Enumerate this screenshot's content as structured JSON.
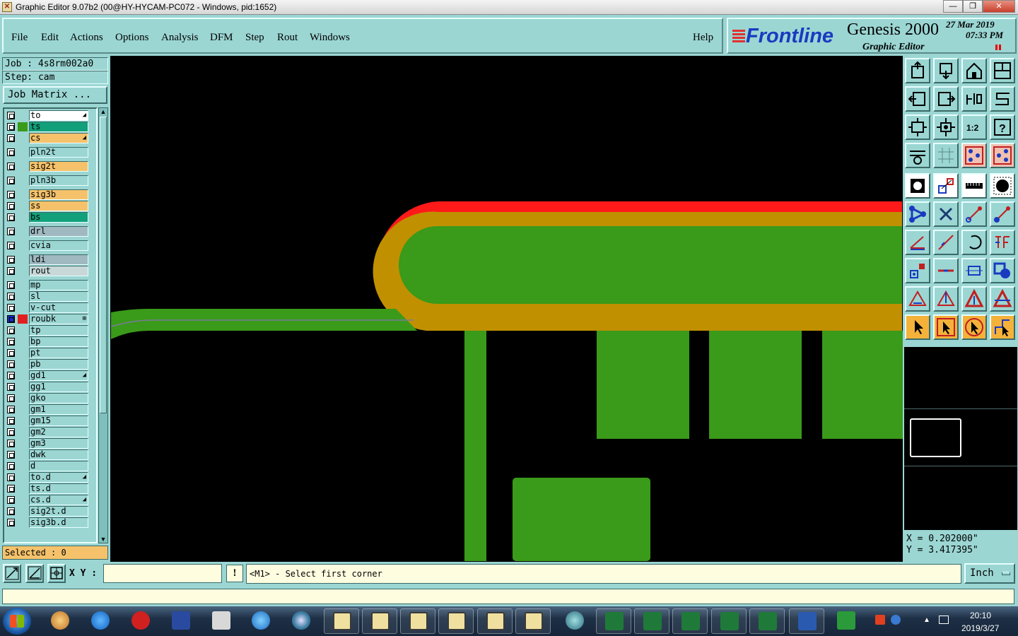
{
  "window": {
    "title": "Graphic Editor 9.07b2 (00@HY-HYCAM-PC072 - Windows, pid:1652)"
  },
  "menu": {
    "items": [
      "File",
      "Edit",
      "Actions",
      "Options",
      "Analysis",
      "DFM",
      "Step",
      "Rout",
      "Windows"
    ],
    "help": "Help"
  },
  "brand": {
    "logo": "Frontline",
    "product": "Genesis 2000",
    "subtitle": "Graphic Editor",
    "date": "27 Mar 2019",
    "time": "07:33 PM"
  },
  "job": {
    "job_label": "Job : 4s8rm002a0",
    "step_label": "Step: cam",
    "matrix_button": "Job Matrix ..."
  },
  "layers": [
    {
      "name": "to",
      "color": "#ffffff",
      "swatch": "",
      "mark": "◢"
    },
    {
      "name": "ts",
      "color": "#12a07a",
      "swatch": "#3a9a1a",
      "mark": ""
    },
    {
      "name": "cs",
      "color": "#f5c26b",
      "swatch": "",
      "mark": "◢"
    },
    {
      "name": "pln2t",
      "color": "#9bd6d3",
      "swatch": "",
      "mark": ""
    },
    {
      "name": "sig2t",
      "color": "#f5c26b",
      "swatch": "",
      "mark": ""
    },
    {
      "name": "pln3b",
      "color": "#9bd6d3",
      "swatch": "",
      "mark": ""
    },
    {
      "name": "sig3b",
      "color": "#f5c26b",
      "swatch": "",
      "mark": ""
    },
    {
      "name": "ss",
      "color": "#f5c26b",
      "swatch": "",
      "mark": ""
    },
    {
      "name": "bs",
      "color": "#12a07a",
      "swatch": "",
      "mark": ""
    },
    {
      "name": "drl",
      "color": "#a0b8c0",
      "swatch": "",
      "mark": ""
    },
    {
      "name": "cvia",
      "color": "#9bd6d3",
      "swatch": "",
      "mark": ""
    },
    {
      "name": "ldi",
      "color": "#a0b8c0",
      "swatch": "",
      "mark": ""
    },
    {
      "name": "rout",
      "color": "#c8d8d8",
      "swatch": "",
      "mark": ""
    },
    {
      "name": "mp",
      "color": "#9bd6d3",
      "swatch": "",
      "mark": ""
    },
    {
      "name": "sl",
      "color": "#9bd6d3",
      "swatch": "",
      "mark": ""
    },
    {
      "name": "v-cut",
      "color": "#9bd6d3",
      "swatch": "",
      "mark": ""
    },
    {
      "name": "roubk",
      "color": "#9bd6d3",
      "swatch": "#e02020",
      "mark": "⊞",
      "active": true
    },
    {
      "name": "tp",
      "color": "#9bd6d3",
      "swatch": "",
      "mark": ""
    },
    {
      "name": "bp",
      "color": "#9bd6d3",
      "swatch": "",
      "mark": ""
    },
    {
      "name": "pt",
      "color": "#9bd6d3",
      "swatch": "",
      "mark": ""
    },
    {
      "name": "pb",
      "color": "#9bd6d3",
      "swatch": "",
      "mark": ""
    },
    {
      "name": "gd1",
      "color": "#9bd6d3",
      "swatch": "",
      "mark": "◢"
    },
    {
      "name": "gg1",
      "color": "#9bd6d3",
      "swatch": "",
      "mark": ""
    },
    {
      "name": "gko",
      "color": "#9bd6d3",
      "swatch": "",
      "mark": ""
    },
    {
      "name": "gm1",
      "color": "#9bd6d3",
      "swatch": "",
      "mark": ""
    },
    {
      "name": "gm15",
      "color": "#9bd6d3",
      "swatch": "",
      "mark": ""
    },
    {
      "name": "gm2",
      "color": "#9bd6d3",
      "swatch": "",
      "mark": ""
    },
    {
      "name": "gm3",
      "color": "#9bd6d3",
      "swatch": "",
      "mark": ""
    },
    {
      "name": "dwk",
      "color": "#9bd6d3",
      "swatch": "",
      "mark": ""
    },
    {
      "name": "d",
      "color": "#9bd6d3",
      "swatch": "",
      "mark": ""
    },
    {
      "name": "to.d",
      "color": "#9bd6d3",
      "swatch": "",
      "mark": "◢"
    },
    {
      "name": "ts.d",
      "color": "#9bd6d3",
      "swatch": "",
      "mark": ""
    },
    {
      "name": "cs.d",
      "color": "#9bd6d3",
      "swatch": "",
      "mark": "◢"
    },
    {
      "name": "sig2t.d",
      "color": "#9bd6d3",
      "swatch": "",
      "mark": ""
    },
    {
      "name": "sig3b.d",
      "color": "#9bd6d3",
      "swatch": "",
      "mark": ""
    }
  ],
  "selected": "Selected : 0",
  "coords": {
    "x": "X = 0.202000\"",
    "y": "Y = 3.417395\""
  },
  "command": {
    "xy_label": "X Y :",
    "xy_value": "",
    "bang": "!",
    "prompt": "<M1> - Select first corner",
    "units": "Inch"
  },
  "taskbar": {
    "time": "20:10",
    "date": "2019/3/27"
  },
  "colors": {
    "panel": "#9bd6d3",
    "copper": "#3a9a1a",
    "mask": "#c09000",
    "outline": "#ff1a1a",
    "highlight": "#f5c26b"
  }
}
